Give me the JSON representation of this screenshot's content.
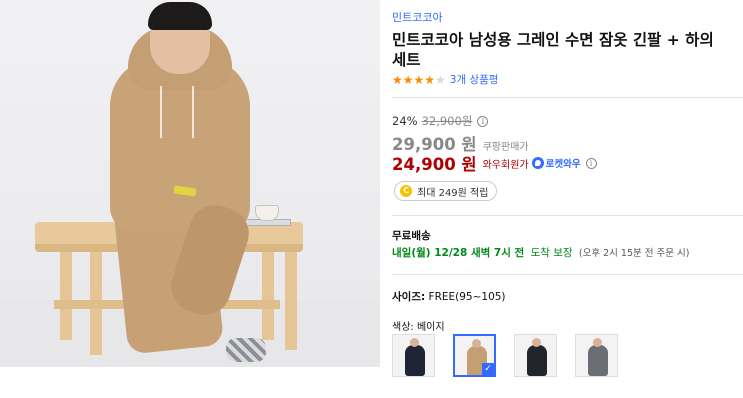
{
  "product": {
    "brand": "민트코코아",
    "title": "민트코코아 남성용 그레인 수면 잠옷 긴팔 + 하의 세트",
    "rating_stars": 4,
    "review_count": "3개 상품평",
    "image_alt": "product photo"
  },
  "price": {
    "discount_rate": "24%",
    "original_price": "32,900원",
    "sale_price": "29,900 원",
    "sale_label": "쿠팡판매가",
    "member_price": "24,900 원",
    "member_label": "와우회원가",
    "rocket_label": "로켓와우",
    "info_symbol": "i"
  },
  "cash": {
    "coin_symbol": "C",
    "text": "최대 249원 적립"
  },
  "shipping": {
    "label": "무료배송",
    "delivery_date": "내일(월) 12/28 새벽 7시 전",
    "delivery_note": "도착 보장",
    "delivery_cutoff": "(오후 2시 15분 전 주문 시)"
  },
  "size": {
    "label": "사이즈:",
    "value": "FREE(95~105)"
  },
  "color": {
    "label": "색상:",
    "value": "베이지",
    "check_symbol": "✓",
    "swatches": [
      {
        "name": "navy",
        "fill": "#1f2436"
      },
      {
        "name": "beige",
        "fill": "#c59f74"
      },
      {
        "name": "black",
        "fill": "#22252b"
      },
      {
        "name": "gray",
        "fill": "#6b6e74"
      }
    ]
  },
  "colors": {
    "link_blue": "#346aff",
    "member_red": "#ae0000",
    "delivery_green": "#00891a",
    "star_orange": "#ff8a00"
  }
}
